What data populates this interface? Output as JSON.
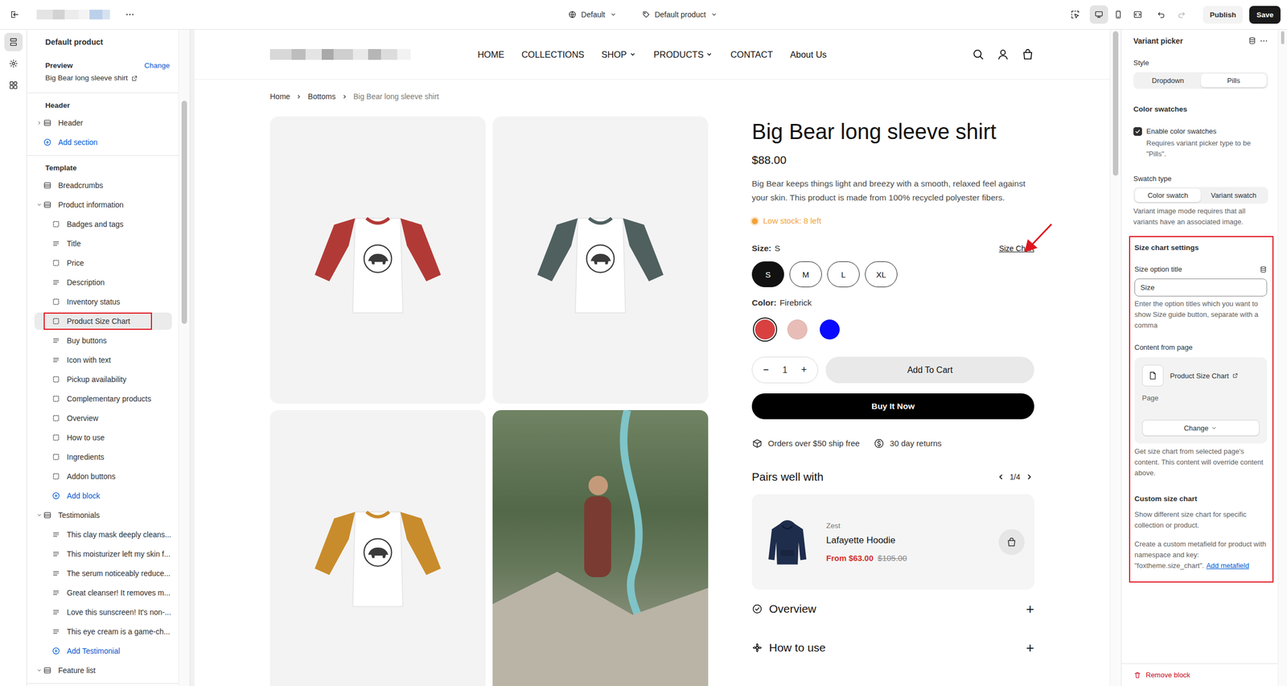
{
  "topbar": {
    "theme": "Default",
    "template": "Default product",
    "inspector": {
      "on": false
    },
    "devices": [
      {
        "selected": true
      },
      {
        "selected": false
      },
      {
        "selected": false
      }
    ],
    "undo": {
      "disabled": false
    },
    "redo": {
      "disabled": true
    },
    "publish": "Publish",
    "save": "Save"
  },
  "rail": [
    {
      "selected": true
    },
    {
      "selected": false
    },
    {
      "selected": false
    }
  ],
  "editor": {
    "title": "Default product",
    "preview_label": "Preview",
    "change": "Change",
    "preview_product": "Big Bear long sleeve shirt",
    "groups": [
      {
        "label": "Header",
        "items": [
          {
            "label": "Header",
            "kind": "section",
            "expanded": false,
            "selected": false
          },
          {
            "label": "Add section",
            "kind": "add-section",
            "selected": false
          }
        ]
      },
      {
        "label": "Template",
        "items": [
          {
            "label": "Breadcrumbs",
            "kind": "section-plain",
            "selected": false
          },
          {
            "label": "Product information",
            "kind": "section",
            "expanded": true,
            "selected": false
          },
          {
            "label": "Badges and tags",
            "kind": "block",
            "selected": false
          },
          {
            "label": "Title",
            "kind": "text",
            "selected": false
          },
          {
            "label": "Price",
            "kind": "block",
            "selected": false
          },
          {
            "label": "Description",
            "kind": "text",
            "selected": false
          },
          {
            "label": "Inventory status",
            "kind": "block",
            "selected": false
          },
          {
            "label": "Product Size Chart",
            "kind": "block",
            "selected": true,
            "annotated": true
          },
          {
            "label": "Buy buttons",
            "kind": "text",
            "selected": false
          },
          {
            "label": "Icon with text",
            "kind": "text",
            "selected": false
          },
          {
            "label": "Pickup availability",
            "kind": "block",
            "selected": false
          },
          {
            "label": "Complementary products",
            "kind": "block",
            "selected": false
          },
          {
            "label": "Overview",
            "kind": "block",
            "selected": false
          },
          {
            "label": "How to use",
            "kind": "block",
            "selected": false
          },
          {
            "label": "Ingredients",
            "kind": "block",
            "selected": false
          },
          {
            "label": "Addon buttons",
            "kind": "block",
            "selected": false
          },
          {
            "label": "Add block",
            "kind": "add-block",
            "selected": false
          },
          {
            "label": "Testimonials",
            "kind": "section",
            "expanded": true,
            "selected": false
          },
          {
            "label": "This clay mask deeply cleans...",
            "kind": "text",
            "selected": false
          },
          {
            "label": "This moisturizer left my skin f...",
            "kind": "text",
            "selected": false
          },
          {
            "label": "The serum noticeably reduce...",
            "kind": "text",
            "selected": false
          },
          {
            "label": "Great cleanser! It removes m...",
            "kind": "text",
            "selected": false
          },
          {
            "label": "Love this sunscreen! It's non-...",
            "kind": "text",
            "selected": false
          },
          {
            "label": "This eye cream is a game-ch...",
            "kind": "text",
            "selected": false
          },
          {
            "label": "Add Testimonial",
            "kind": "add-block",
            "selected": false
          },
          {
            "label": "Feature list",
            "kind": "section",
            "expanded": true,
            "selected": false
          }
        ]
      }
    ]
  },
  "store": {
    "nav": [
      {
        "label": "HOME",
        "dropdown": false
      },
      {
        "label": "COLLECTIONS",
        "dropdown": false
      },
      {
        "label": "SHOP",
        "dropdown": true
      },
      {
        "label": "PRODUCTS",
        "dropdown": true
      },
      {
        "label": "CONTACT",
        "dropdown": false
      },
      {
        "label": "About Us",
        "dropdown": false
      }
    ],
    "breadcrumb": [
      "Home",
      "Bottoms",
      "Big Bear long sleeve shirt"
    ]
  },
  "gallery": [
    {
      "kind": "shirt",
      "color": "#b23a36"
    },
    {
      "kind": "shirt",
      "color": "#4f605f"
    },
    {
      "kind": "shirt",
      "color": "#c98c2c"
    },
    {
      "kind": "photo",
      "color": "#5a6e4e"
    }
  ],
  "product": {
    "title": "Big Bear long sleeve shirt",
    "price": "$88.00",
    "description": "Big Bear keeps things light and breezy with a smooth, relaxed feel against your skin. This product is made from 100% recycled polyester fibers.",
    "stock": {
      "text": "Low stock: 8 left",
      "color": "#f0a23b"
    },
    "size": {
      "label": "Size:",
      "value": "S",
      "chart_link": "Size Chart",
      "arrow": true,
      "options": [
        {
          "label": "S",
          "selected": true
        },
        {
          "label": "M",
          "selected": false
        },
        {
          "label": "L",
          "selected": false
        },
        {
          "label": "XL",
          "selected": false
        }
      ]
    },
    "color": {
      "label": "Color:",
      "value": "Firebrick",
      "swatches": [
        {
          "color": "#d94141",
          "selected": true
        },
        {
          "color": "#e9bdb7",
          "selected": false
        },
        {
          "color": "#0a0aff",
          "selected": false
        }
      ]
    },
    "quantity": {
      "minus": "−",
      "value": "1",
      "plus": "+"
    },
    "add_to_cart": "Add To Cart",
    "buy_now": "Buy It Now",
    "perks": [
      {
        "text": "Orders over $50 ship free",
        "kind": "shipping"
      },
      {
        "text": "30 day returns",
        "kind": "returns"
      }
    ],
    "pairs": {
      "title": "Pairs well with",
      "page": "1/4",
      "items": [
        {
          "vendor": "Zest",
          "name": "Lafayette Hoodie",
          "price": "From $63.00",
          "compare": "$105.00"
        }
      ]
    },
    "accordions": [
      {
        "label": "Overview",
        "kind": "check",
        "expanded": false,
        "toggle": "+"
      },
      {
        "label": "How to use",
        "kind": "gear",
        "expanded": false,
        "toggle": "+"
      }
    ]
  },
  "settings": {
    "block_title": "Variant picker",
    "style": {
      "label": "Style",
      "options": [
        {
          "label": "Dropdown",
          "selected": false
        },
        {
          "label": "Pills",
          "selected": true
        }
      ]
    },
    "color_swatches": {
      "title": "Color swatches",
      "checkbox": {
        "label": "Enable color swatches",
        "checked": true
      },
      "note": "Requires variant picker type to be \"Pills\"."
    },
    "swatch_type": {
      "label": "Swatch type",
      "options": [
        {
          "label": "Color swatch",
          "selected": true
        },
        {
          "label": "Variant swatch",
          "selected": false
        }
      ],
      "note": "Variant image mode requires that all variants have an associated image."
    },
    "size_chart": {
      "annotated": true,
      "title": "Size chart settings",
      "option_label": "Size option title",
      "option_value": "Size",
      "option_help": "Enter the option titles which you want to show Size guide button, separate with a comma",
      "content_label": "Content from page",
      "page": {
        "name": "Product Size Chart",
        "type": "Page"
      },
      "change": "Change",
      "content_help": "Get size chart from selected page's content. This content will override content above.",
      "custom_title": "Custom size chart",
      "custom_text": "Show different size chart for specific collection or product.",
      "metafield_text": "Create a custom metafield for product with namespace and key: \"foxtheme.size_chart\".",
      "metafield_link": "Add metafield"
    },
    "remove": "Remove block"
  },
  "scrollbars": {
    "editor": {
      "level": 0.34
    },
    "preview": {
      "level": 0.22
    },
    "settings": {
      "level": 0.02
    }
  }
}
